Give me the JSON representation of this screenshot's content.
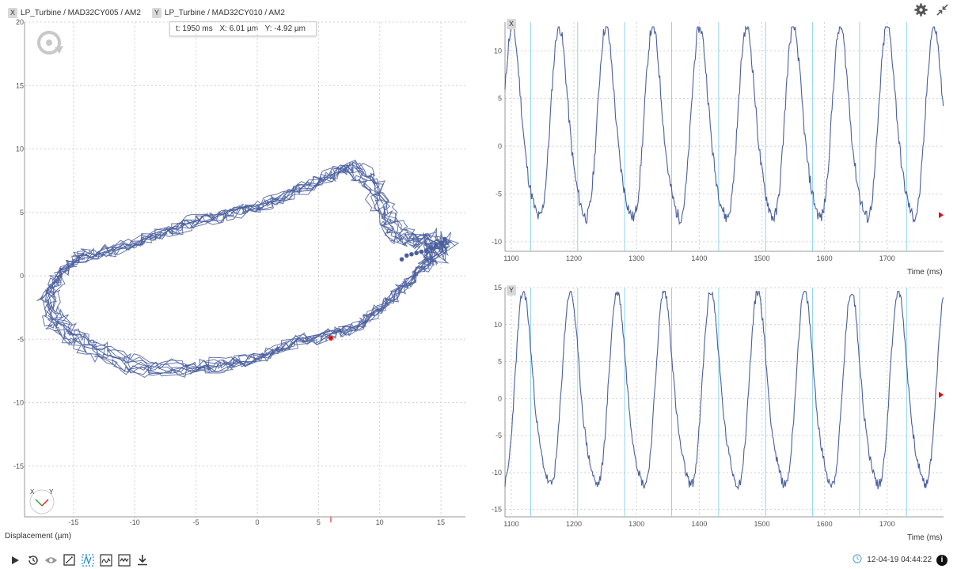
{
  "legend": {
    "x_chip": "X",
    "x_label": "LP_Turbine / MAD32CY005 / AM2",
    "y_chip": "Y",
    "y_label": "LP_Turbine / MAD32CY010 / AM2"
  },
  "tooltip": {
    "t": "t: 1950 ms",
    "x": "X: 6.01 µm",
    "y": "Y: -4.92 µm"
  },
  "orbit": {
    "xlabel": "Displacement (µm)",
    "axis_icon_x": "X",
    "axis_icon_y": "Y"
  },
  "panel_x": {
    "chip": "X",
    "xlabel": "Time (ms)"
  },
  "panel_y": {
    "chip": "Y",
    "xlabel": "Time (ms)"
  },
  "timestamp": "12-04-19 04:44:22",
  "colors": {
    "trace": "#4a5f9e",
    "grid": "#d0d0d0",
    "marker": "#e01010",
    "keyphasor": "#8fd3ee"
  },
  "icons": [
    "play-icon",
    "history-icon",
    "eye-icon",
    "fullscreen-icon",
    "orbit-view-icon",
    "waveform-view-icon",
    "spectrum-view-icon",
    "download-icon",
    "settings-icon",
    "collapse-icon",
    "clock-icon",
    "info-icon",
    "rotation-icon",
    "axis-orientation-icon"
  ],
  "chart_data": [
    {
      "type": "scatter",
      "subtype": "orbit",
      "xlabel": "Displacement (µm)",
      "ylabel": "",
      "xlim": [
        -19,
        17
      ],
      "ylim": [
        -19,
        20
      ],
      "xticks": [
        -15,
        -10,
        -5,
        0,
        5,
        10,
        15
      ],
      "yticks": [
        -15,
        -10,
        -5,
        0,
        5,
        10,
        15,
        20
      ],
      "grid": true,
      "loops": 10,
      "orbit_shape": [
        [
          15.2,
          2.5
        ],
        [
          13.5,
          2.8
        ],
        [
          11.5,
          3.2
        ],
        [
          10.5,
          5.0
        ],
        [
          9.5,
          7.2
        ],
        [
          8.0,
          8.6
        ],
        [
          6.0,
          8.0
        ],
        [
          3.0,
          6.5
        ],
        [
          0.0,
          5.5
        ],
        [
          -3.0,
          4.8
        ],
        [
          -6.0,
          4.0
        ],
        [
          -9.0,
          2.9
        ],
        [
          -12.0,
          2.0
        ],
        [
          -14.5,
          1.5
        ],
        [
          -16.0,
          0.2
        ],
        [
          -17.0,
          -1.5
        ],
        [
          -16.5,
          -3.5
        ],
        [
          -15.0,
          -4.8
        ],
        [
          -12.5,
          -6.0
        ],
        [
          -9.5,
          -7.2
        ],
        [
          -6.0,
          -7.3
        ],
        [
          -3.0,
          -7.0
        ],
        [
          0.0,
          -6.5
        ],
        [
          3.0,
          -5.2
        ],
        [
          6.0,
          -4.6
        ],
        [
          8.5,
          -3.8
        ],
        [
          10.5,
          -2.2
        ],
        [
          12.5,
          -0.4
        ],
        [
          14.5,
          1.4
        ],
        [
          15.2,
          2.5
        ]
      ],
      "end_dots": [
        [
          11.8,
          1.3
        ],
        [
          12.2,
          1.6
        ],
        [
          12.6,
          1.7
        ],
        [
          13.0,
          1.8
        ],
        [
          13.4,
          1.9
        ],
        [
          13.8,
          2.0
        ],
        [
          14.2,
          2.2
        ],
        [
          14.6,
          2.4
        ],
        [
          15.0,
          2.6
        ],
        [
          15.3,
          2.9
        ]
      ],
      "current_point": {
        "x": 6.01,
        "y": -4.92
      }
    },
    {
      "type": "line",
      "name": "X",
      "xlabel": "Time (ms)",
      "xlim": [
        1090,
        1790
      ],
      "ylim": [
        -11,
        13
      ],
      "xticks": [
        1100,
        1200,
        1300,
        1400,
        1500,
        1600,
        1700
      ],
      "yticks": [
        -10,
        -5,
        0,
        5,
        10
      ],
      "grid": true,
      "period_ms": 74.8,
      "phase_ms": 1103,
      "amplitude": [
        -8.5,
        11.0
      ],
      "keyphasor_ms": [
        1131,
        1206,
        1281,
        1356,
        1431,
        1506,
        1581,
        1656,
        1731
      ]
    },
    {
      "type": "line",
      "name": "Y",
      "xlabel": "Time (ms)",
      "xlim": [
        1090,
        1790
      ],
      "ylim": [
        -16,
        15
      ],
      "xticks": [
        1100,
        1200,
        1300,
        1400,
        1500,
        1600,
        1700
      ],
      "yticks": [
        -15,
        -10,
        -5,
        0,
        5,
        10,
        15
      ],
      "grid": true,
      "period_ms": 74.8,
      "phase_ms": 1121,
      "amplitude": [
        -13.0,
        12.5
      ],
      "keyphasor_ms": [
        1131,
        1206,
        1281,
        1356,
        1431,
        1506,
        1581,
        1656,
        1731
      ]
    }
  ]
}
